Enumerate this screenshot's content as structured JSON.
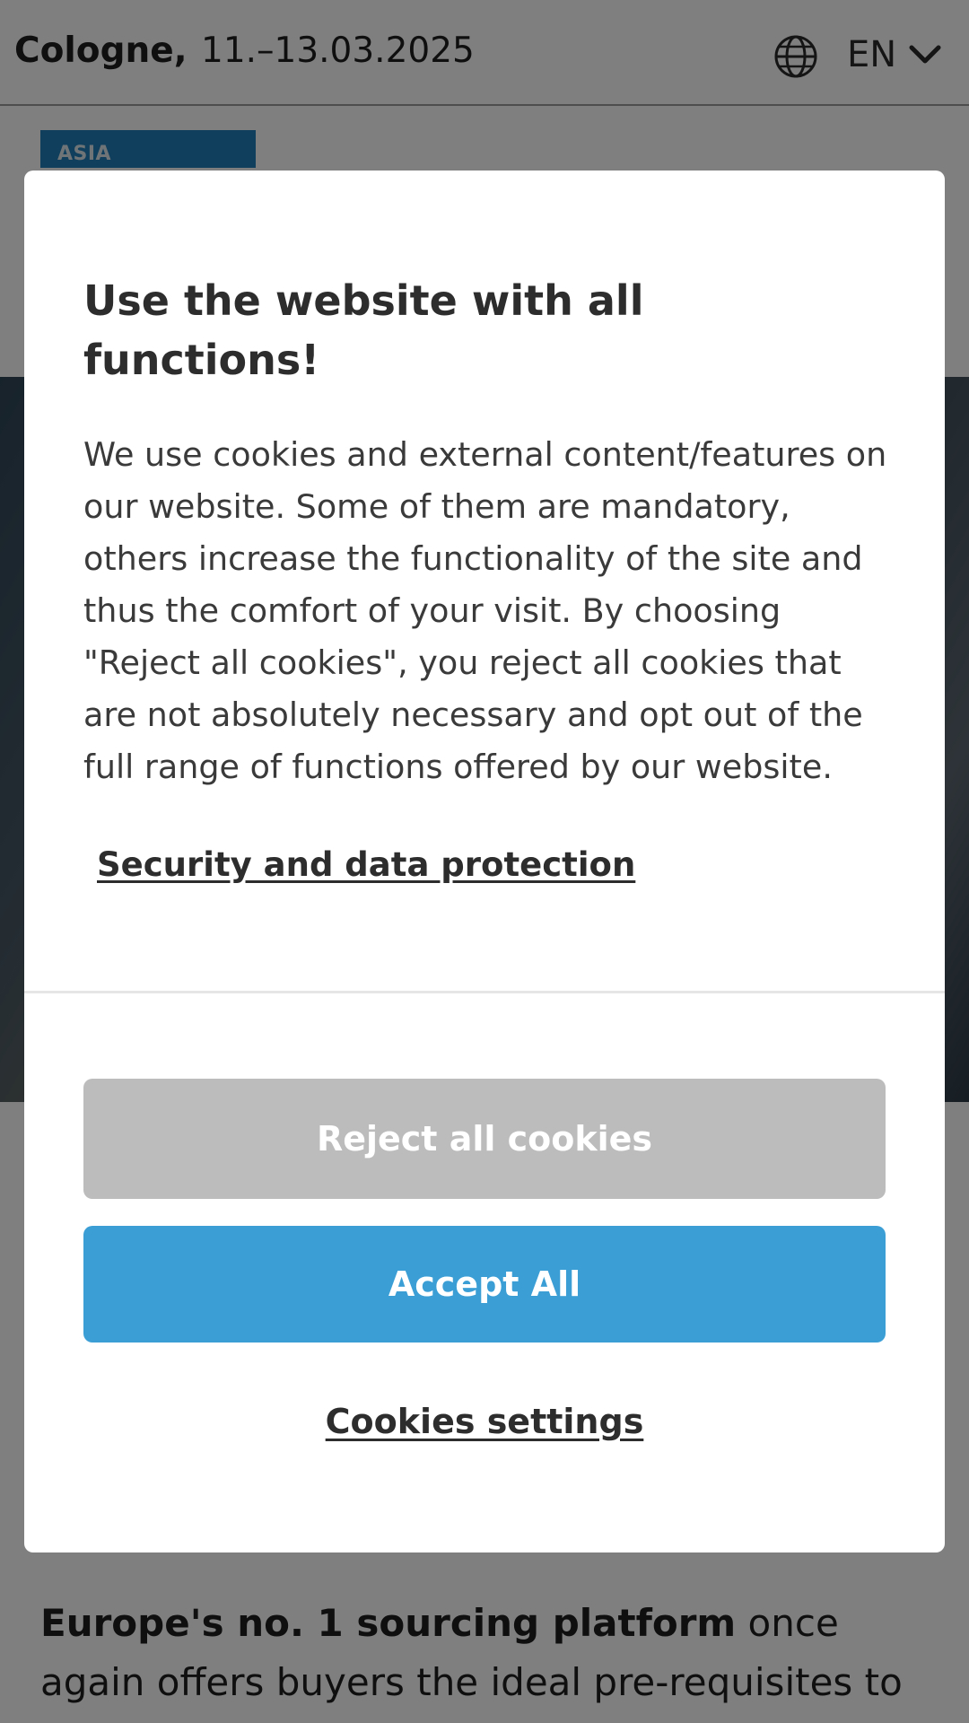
{
  "header": {
    "city": "Cologne,",
    "dates": "11.–13.03.2025",
    "language": "EN",
    "globe_icon": "globe-icon",
    "chevron_icon": "chevron-down-icon"
  },
  "logo": {
    "text": "ASIA"
  },
  "lead": {
    "bold": "Europe's no. 1 sourcing platform",
    "rest": " once again offers buyers the ideal pre-requisites to"
  },
  "cookie_dialog": {
    "title": "Use the website with all functions!",
    "body": "We use cookies and external content/features on our website. Some of them are mandatory, others increase the functionality of the site and thus the comfort of your visit. By choosing \"Reject all cookies\", you reject all cookies that are not absolutely necessary and opt out of the full range of functions offered by our website.",
    "security_link": "Security and data protection",
    "reject_label": "Reject all cookies",
    "accept_label": "Accept All",
    "settings_label": "Cookies settings"
  },
  "colors": {
    "accept": "#3b9fd6",
    "reject": "#bcbcbc",
    "brand": "#1e7fb8"
  }
}
